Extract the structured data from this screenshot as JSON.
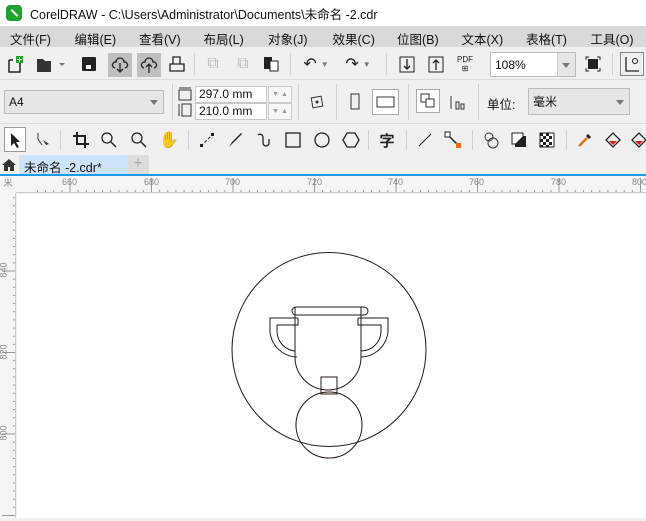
{
  "window": {
    "title": "CorelDRAW - C:\\Users\\Administrator\\Documents\\未命名 -2.cdr"
  },
  "menu": [
    "文件(F)",
    "编辑(E)",
    "查看(V)",
    "布局(L)",
    "对象(J)",
    "效果(C)",
    "位图(B)",
    "文本(X)",
    "表格(T)",
    "工具(O)"
  ],
  "standard_toolbar": {
    "zoom": "108%",
    "pdf_label": "PDF"
  },
  "property_bar": {
    "page_size": "A4",
    "width": "297.0 mm",
    "height": "210.0 mm",
    "units_label": "单位:",
    "units": "毫米"
  },
  "toolbox": {
    "text_tool": "字"
  },
  "tabs": {
    "document": "未命名 -2.cdr*",
    "add": "+"
  },
  "ruler": {
    "top": [
      "660",
      "680",
      "700",
      "720",
      "740",
      "760",
      "780",
      "800"
    ],
    "left": [
      "840",
      "820",
      "800"
    ],
    "unit": "米"
  },
  "colors": {
    "accent": "#1e9be8",
    "logo": "#1fa22e",
    "tab": "#cde3f9"
  }
}
